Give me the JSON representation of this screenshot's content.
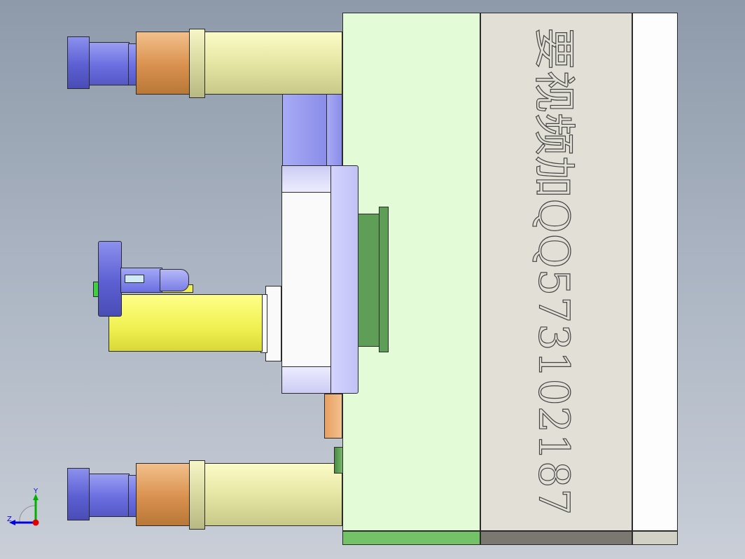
{
  "viewport": {
    "watermark_text": "要视频加QQ573102187",
    "background_colors": [
      "#8e9aaa",
      "#c9ced7"
    ]
  },
  "triad": {
    "y_label": "Y",
    "z_label": "Z",
    "axis_colors": {
      "y": "#00b000",
      "z": "#0000e0",
      "origin": "#e00000"
    }
  },
  "colors": {
    "green_plate": "#e3fbd6",
    "gray_plate": "#e2e0d6",
    "white_plate": "#fdfdfd",
    "pillar_body": "#e6e6a4",
    "pillar_bush": "#d9904e",
    "pillar_cap": "#5c5fd2",
    "yellow_bar": "#f0f050",
    "dark_green_insert": "#5e9e56"
  }
}
